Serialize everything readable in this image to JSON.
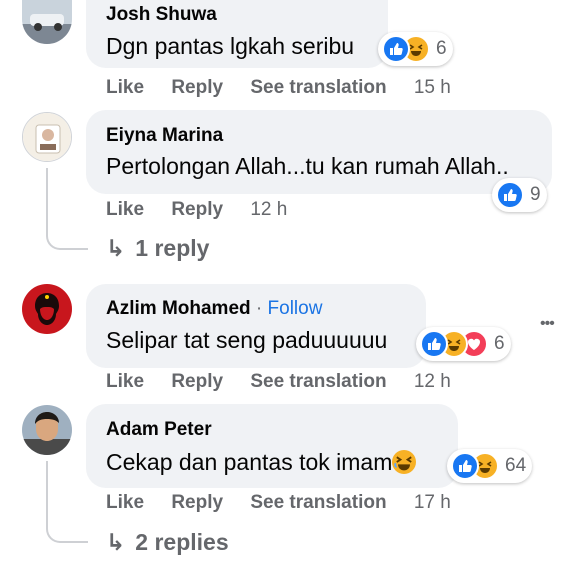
{
  "comments": [
    {
      "name": "Josh Shuwa",
      "text": "Dgn pantas lgkah seribu",
      "reaction_count": "6",
      "actions": {
        "like": "Like",
        "reply": "Reply",
        "translation": "See translation",
        "time": "15 h"
      }
    },
    {
      "name": "Eiyna Marina",
      "text": "Pertolongan Allah...tu kan rumah Allah..",
      "reaction_count": "9",
      "actions": {
        "like": "Like",
        "reply": "Reply",
        "time": "12 h"
      },
      "replies_label": "1 reply"
    },
    {
      "name": "Azlim Mohamed",
      "follow_label": "Follow",
      "text": "Selipar tat seng paduuuuuu",
      "reaction_count": "6",
      "actions": {
        "like": "Like",
        "reply": "Reply",
        "translation": "See translation",
        "time": "12 h"
      }
    },
    {
      "name": "Adam Peter",
      "text": "Cekap dan pantas tok imam",
      "reaction_count": "64",
      "actions": {
        "like": "Like",
        "reply": "Reply",
        "translation": "See translation",
        "time": "17 h"
      },
      "replies_label": "2 replies"
    }
  ],
  "more_label": "•••",
  "colors": {
    "bubble": "#f0f2f5",
    "like": "#1877f2",
    "haha": "#f7b125",
    "love": "#f33e58",
    "link": "#1b74e4",
    "meta": "#65676b"
  }
}
